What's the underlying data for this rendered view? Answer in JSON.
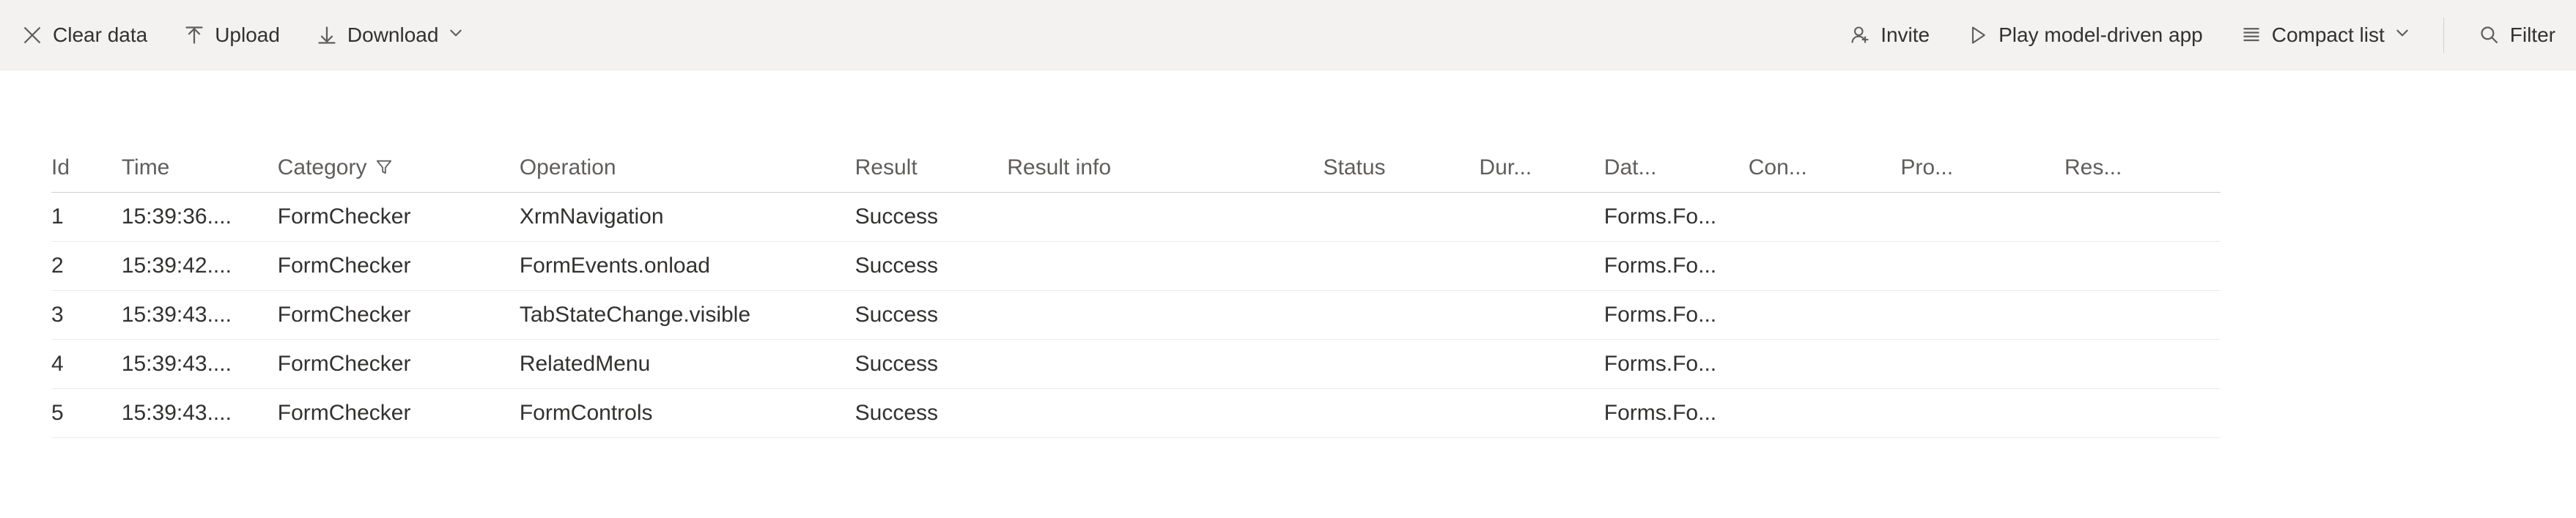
{
  "toolbar": {
    "clear_data": "Clear data",
    "upload": "Upload",
    "download": "Download",
    "invite": "Invite",
    "play_app": "Play model-driven app",
    "compact_list": "Compact list",
    "filter": "Filter"
  },
  "columns": {
    "id": "Id",
    "time": "Time",
    "category": "Category",
    "operation": "Operation",
    "result": "Result",
    "result_info": "Result info",
    "status": "Status",
    "duration": "Dur...",
    "data": "Dat...",
    "con": "Con...",
    "pro": "Pro...",
    "res": "Res..."
  },
  "rows": [
    {
      "id": "1",
      "time": "15:39:36....",
      "category": "FormChecker",
      "operation": "XrmNavigation",
      "result": "Success",
      "result_info": "",
      "status": "",
      "duration": "",
      "data": "Forms.Fo...",
      "con": "",
      "pro": "",
      "res": ""
    },
    {
      "id": "2",
      "time": "15:39:42....",
      "category": "FormChecker",
      "operation": "FormEvents.onload",
      "result": "Success",
      "result_info": "",
      "status": "",
      "duration": "",
      "data": "Forms.Fo...",
      "con": "",
      "pro": "",
      "res": ""
    },
    {
      "id": "3",
      "time": "15:39:43....",
      "category": "FormChecker",
      "operation": "TabStateChange.visible",
      "result": "Success",
      "result_info": "",
      "status": "",
      "duration": "",
      "data": "Forms.Fo...",
      "con": "",
      "pro": "",
      "res": ""
    },
    {
      "id": "4",
      "time": "15:39:43....",
      "category": "FormChecker",
      "operation": "RelatedMenu",
      "result": "Success",
      "result_info": "",
      "status": "",
      "duration": "",
      "data": "Forms.Fo...",
      "con": "",
      "pro": "",
      "res": ""
    },
    {
      "id": "5",
      "time": "15:39:43....",
      "category": "FormChecker",
      "operation": "FormControls",
      "result": "Success",
      "result_info": "",
      "status": "",
      "duration": "",
      "data": "Forms.Fo...",
      "con": "",
      "pro": "",
      "res": ""
    }
  ]
}
